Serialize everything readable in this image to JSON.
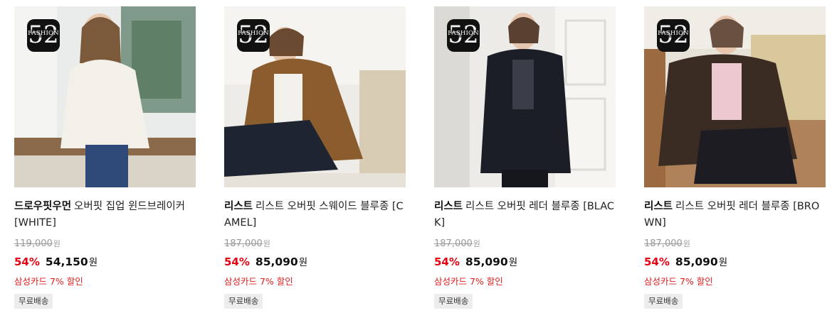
{
  "badge": {
    "word": "FASHION",
    "number": "52"
  },
  "products": [
    {
      "brand": "드로우핏우먼",
      "name": "오버핏 집업 윈드브레이커 [WHITE]",
      "original_price": "119,000",
      "currency": "원",
      "discount_rate": "54%",
      "sale_price": "54,150",
      "card_discount": "삼성카드 7% 할인",
      "shipping_tag": "무료배송"
    },
    {
      "brand": "리스트",
      "name": "리스트 오버핏 스웨이드 블루종 [CAMEL]",
      "original_price": "187,000",
      "currency": "원",
      "discount_rate": "54%",
      "sale_price": "85,090",
      "card_discount": "삼성카드 7% 할인",
      "shipping_tag": "무료배송"
    },
    {
      "brand": "리스트",
      "name": "리스트 오버핏 레더 블루종 [BLACK]",
      "original_price": "187,000",
      "currency": "원",
      "discount_rate": "54%",
      "sale_price": "85,090",
      "card_discount": "삼성카드 7% 할인",
      "shipping_tag": "무료배송"
    },
    {
      "brand": "리스트",
      "name": "리스트 오버핏 레더 블루종 [BROWN]",
      "original_price": "187,000",
      "currency": "원",
      "discount_rate": "54%",
      "sale_price": "85,090",
      "card_discount": "삼성카드 7% 할인",
      "shipping_tag": "무료배송"
    }
  ],
  "colors": {
    "discount_red": "#e60012",
    "card_discount_red": "#e02020",
    "strikethrough_gray": "#999999",
    "tag_bg": "#ededed"
  }
}
